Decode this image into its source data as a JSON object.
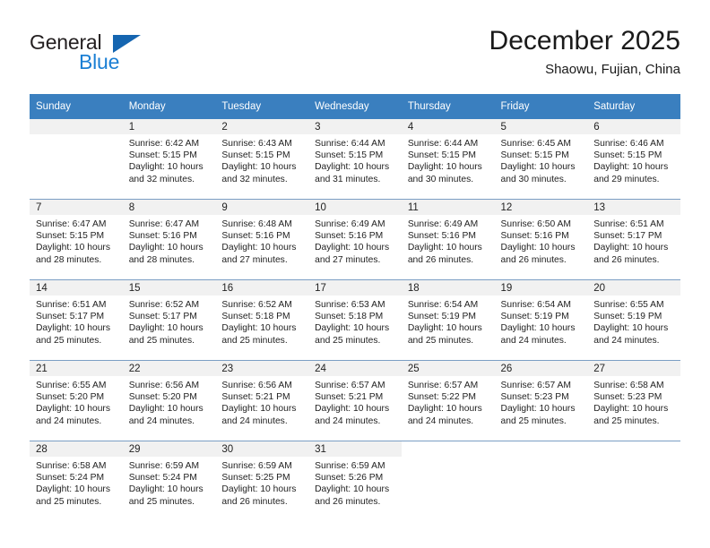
{
  "brand": {
    "name_part1": "General",
    "name_part2": "Blue",
    "primary_color": "#1b7fd4",
    "triangle_color": "#1565b0"
  },
  "header": {
    "month_title": "December 2025",
    "location": "Shaowu, Fujian, China"
  },
  "calendar": {
    "header_color": "#3a7fbf",
    "weekday_headers": [
      "Sunday",
      "Monday",
      "Tuesday",
      "Wednesday",
      "Thursday",
      "Friday",
      "Saturday"
    ],
    "weeks": [
      [
        {
          "day": "",
          "sunrise": "",
          "sunset": "",
          "daylight_line1": "",
          "daylight_line2": "",
          "empty": true
        },
        {
          "day": "1",
          "sunrise": "Sunrise: 6:42 AM",
          "sunset": "Sunset: 5:15 PM",
          "daylight_line1": "Daylight: 10 hours",
          "daylight_line2": "and 32 minutes."
        },
        {
          "day": "2",
          "sunrise": "Sunrise: 6:43 AM",
          "sunset": "Sunset: 5:15 PM",
          "daylight_line1": "Daylight: 10 hours",
          "daylight_line2": "and 32 minutes."
        },
        {
          "day": "3",
          "sunrise": "Sunrise: 6:44 AM",
          "sunset": "Sunset: 5:15 PM",
          "daylight_line1": "Daylight: 10 hours",
          "daylight_line2": "and 31 minutes."
        },
        {
          "day": "4",
          "sunrise": "Sunrise: 6:44 AM",
          "sunset": "Sunset: 5:15 PM",
          "daylight_line1": "Daylight: 10 hours",
          "daylight_line2": "and 30 minutes."
        },
        {
          "day": "5",
          "sunrise": "Sunrise: 6:45 AM",
          "sunset": "Sunset: 5:15 PM",
          "daylight_line1": "Daylight: 10 hours",
          "daylight_line2": "and 30 minutes."
        },
        {
          "day": "6",
          "sunrise": "Sunrise: 6:46 AM",
          "sunset": "Sunset: 5:15 PM",
          "daylight_line1": "Daylight: 10 hours",
          "daylight_line2": "and 29 minutes."
        }
      ],
      [
        {
          "day": "7",
          "sunrise": "Sunrise: 6:47 AM",
          "sunset": "Sunset: 5:15 PM",
          "daylight_line1": "Daylight: 10 hours",
          "daylight_line2": "and 28 minutes."
        },
        {
          "day": "8",
          "sunrise": "Sunrise: 6:47 AM",
          "sunset": "Sunset: 5:16 PM",
          "daylight_line1": "Daylight: 10 hours",
          "daylight_line2": "and 28 minutes."
        },
        {
          "day": "9",
          "sunrise": "Sunrise: 6:48 AM",
          "sunset": "Sunset: 5:16 PM",
          "daylight_line1": "Daylight: 10 hours",
          "daylight_line2": "and 27 minutes."
        },
        {
          "day": "10",
          "sunrise": "Sunrise: 6:49 AM",
          "sunset": "Sunset: 5:16 PM",
          "daylight_line1": "Daylight: 10 hours",
          "daylight_line2": "and 27 minutes."
        },
        {
          "day": "11",
          "sunrise": "Sunrise: 6:49 AM",
          "sunset": "Sunset: 5:16 PM",
          "daylight_line1": "Daylight: 10 hours",
          "daylight_line2": "and 26 minutes."
        },
        {
          "day": "12",
          "sunrise": "Sunrise: 6:50 AM",
          "sunset": "Sunset: 5:16 PM",
          "daylight_line1": "Daylight: 10 hours",
          "daylight_line2": "and 26 minutes."
        },
        {
          "day": "13",
          "sunrise": "Sunrise: 6:51 AM",
          "sunset": "Sunset: 5:17 PM",
          "daylight_line1": "Daylight: 10 hours",
          "daylight_line2": "and 26 minutes."
        }
      ],
      [
        {
          "day": "14",
          "sunrise": "Sunrise: 6:51 AM",
          "sunset": "Sunset: 5:17 PM",
          "daylight_line1": "Daylight: 10 hours",
          "daylight_line2": "and 25 minutes."
        },
        {
          "day": "15",
          "sunrise": "Sunrise: 6:52 AM",
          "sunset": "Sunset: 5:17 PM",
          "daylight_line1": "Daylight: 10 hours",
          "daylight_line2": "and 25 minutes."
        },
        {
          "day": "16",
          "sunrise": "Sunrise: 6:52 AM",
          "sunset": "Sunset: 5:18 PM",
          "daylight_line1": "Daylight: 10 hours",
          "daylight_line2": "and 25 minutes."
        },
        {
          "day": "17",
          "sunrise": "Sunrise: 6:53 AM",
          "sunset": "Sunset: 5:18 PM",
          "daylight_line1": "Daylight: 10 hours",
          "daylight_line2": "and 25 minutes."
        },
        {
          "day": "18",
          "sunrise": "Sunrise: 6:54 AM",
          "sunset": "Sunset: 5:19 PM",
          "daylight_line1": "Daylight: 10 hours",
          "daylight_line2": "and 25 minutes."
        },
        {
          "day": "19",
          "sunrise": "Sunrise: 6:54 AM",
          "sunset": "Sunset: 5:19 PM",
          "daylight_line1": "Daylight: 10 hours",
          "daylight_line2": "and 24 minutes."
        },
        {
          "day": "20",
          "sunrise": "Sunrise: 6:55 AM",
          "sunset": "Sunset: 5:19 PM",
          "daylight_line1": "Daylight: 10 hours",
          "daylight_line2": "and 24 minutes."
        }
      ],
      [
        {
          "day": "21",
          "sunrise": "Sunrise: 6:55 AM",
          "sunset": "Sunset: 5:20 PM",
          "daylight_line1": "Daylight: 10 hours",
          "daylight_line2": "and 24 minutes."
        },
        {
          "day": "22",
          "sunrise": "Sunrise: 6:56 AM",
          "sunset": "Sunset: 5:20 PM",
          "daylight_line1": "Daylight: 10 hours",
          "daylight_line2": "and 24 minutes."
        },
        {
          "day": "23",
          "sunrise": "Sunrise: 6:56 AM",
          "sunset": "Sunset: 5:21 PM",
          "daylight_line1": "Daylight: 10 hours",
          "daylight_line2": "and 24 minutes."
        },
        {
          "day": "24",
          "sunrise": "Sunrise: 6:57 AM",
          "sunset": "Sunset: 5:21 PM",
          "daylight_line1": "Daylight: 10 hours",
          "daylight_line2": "and 24 minutes."
        },
        {
          "day": "25",
          "sunrise": "Sunrise: 6:57 AM",
          "sunset": "Sunset: 5:22 PM",
          "daylight_line1": "Daylight: 10 hours",
          "daylight_line2": "and 24 minutes."
        },
        {
          "day": "26",
          "sunrise": "Sunrise: 6:57 AM",
          "sunset": "Sunset: 5:23 PM",
          "daylight_line1": "Daylight: 10 hours",
          "daylight_line2": "and 25 minutes."
        },
        {
          "day": "27",
          "sunrise": "Sunrise: 6:58 AM",
          "sunset": "Sunset: 5:23 PM",
          "daylight_line1": "Daylight: 10 hours",
          "daylight_line2": "and 25 minutes."
        }
      ],
      [
        {
          "day": "28",
          "sunrise": "Sunrise: 6:58 AM",
          "sunset": "Sunset: 5:24 PM",
          "daylight_line1": "Daylight: 10 hours",
          "daylight_line2": "and 25 minutes."
        },
        {
          "day": "29",
          "sunrise": "Sunrise: 6:59 AM",
          "sunset": "Sunset: 5:24 PM",
          "daylight_line1": "Daylight: 10 hours",
          "daylight_line2": "and 25 minutes."
        },
        {
          "day": "30",
          "sunrise": "Sunrise: 6:59 AM",
          "sunset": "Sunset: 5:25 PM",
          "daylight_line1": "Daylight: 10 hours",
          "daylight_line2": "and 26 minutes."
        },
        {
          "day": "31",
          "sunrise": "Sunrise: 6:59 AM",
          "sunset": "Sunset: 5:26 PM",
          "daylight_line1": "Daylight: 10 hours",
          "daylight_line2": "and 26 minutes."
        },
        {
          "day": "",
          "sunrise": "",
          "sunset": "",
          "daylight_line1": "",
          "daylight_line2": "",
          "blank": true
        },
        {
          "day": "",
          "sunrise": "",
          "sunset": "",
          "daylight_line1": "",
          "daylight_line2": "",
          "blank": true
        },
        {
          "day": "",
          "sunrise": "",
          "sunset": "",
          "daylight_line1": "",
          "daylight_line2": "",
          "blank": true
        }
      ]
    ]
  }
}
